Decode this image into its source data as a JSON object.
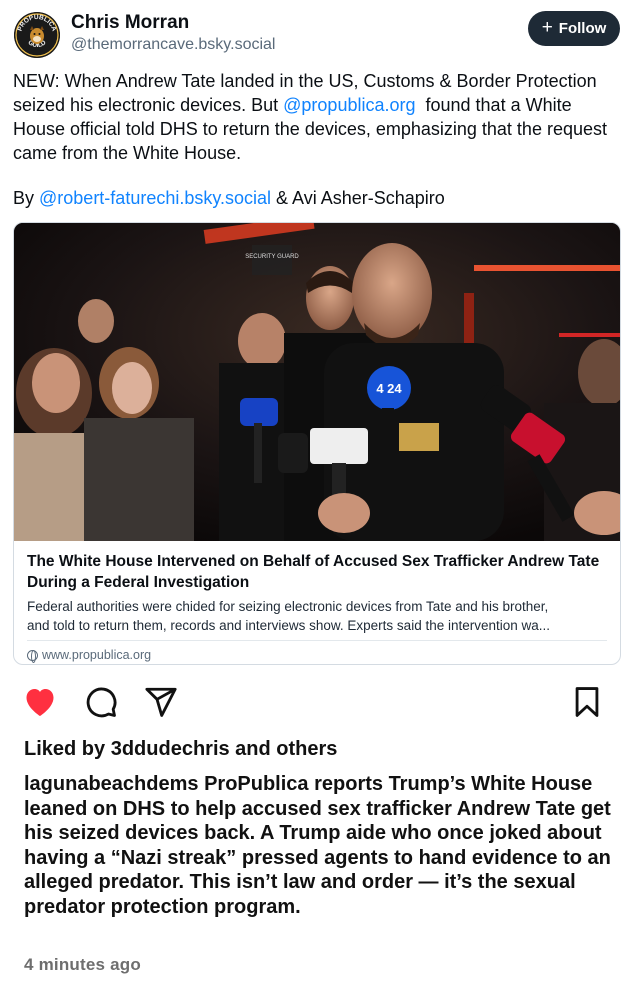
{
  "bsky_post": {
    "author_name": "Chris Morran",
    "author_handle": "@themorrancave.bsky.social",
    "avatar_text_top": "PROPUBLICA",
    "avatar_text_bottom": "GUILD",
    "follow_label": "Follow",
    "text_part1": "NEW: When Andrew Tate landed in the US, Customs & Border Protection seized his electronic devices. But ",
    "text_mention": "@propublica.org",
    "text_part2": "  found that a White House official told DHS to return the devices, emphasizing that the request came from the White House.",
    "byline_prefix": "By ",
    "byline_mention": "@robert-faturechi.bsky.social",
    "byline_suffix": " & Avi Asher-Schapiro",
    "embed": {
      "image_sign_text": "SECURITY GUARD",
      "mic_label_1": "4 24",
      "title": "The White House Intervened on Behalf of Accused Sex Trafficker Andrew Tate During a Federal Investigation",
      "description_line1": "Federal authorities were chided for seizing electronic devices from Tate and his brother,",
      "description_line2": "and told to return them, records and interviews show. Experts said the intervention wa...",
      "domain": "www.propublica.org"
    }
  },
  "instagram": {
    "liked_by_prefix": "Liked by ",
    "liked_by_user": "3ddudechris",
    "liked_by_and": " and ",
    "liked_by_others": "others",
    "caption_user": "lagunabeachdems",
    "caption_text": " ProPublica reports Trump’s White House leaned on DHS to help accused sex trafficker Andrew Tate get his seized devices back. A Trump aide who once joked about having a “Nazi streak” pressed agents to hand evidence to an alleged predator. This isn’t law and order — it’s the sexual predator protection program.",
    "timestamp": "4 minutes ago",
    "icons": [
      "heart-icon",
      "comment-icon",
      "share-icon",
      "bookmark-icon"
    ],
    "heart_color": "#ff3040"
  }
}
